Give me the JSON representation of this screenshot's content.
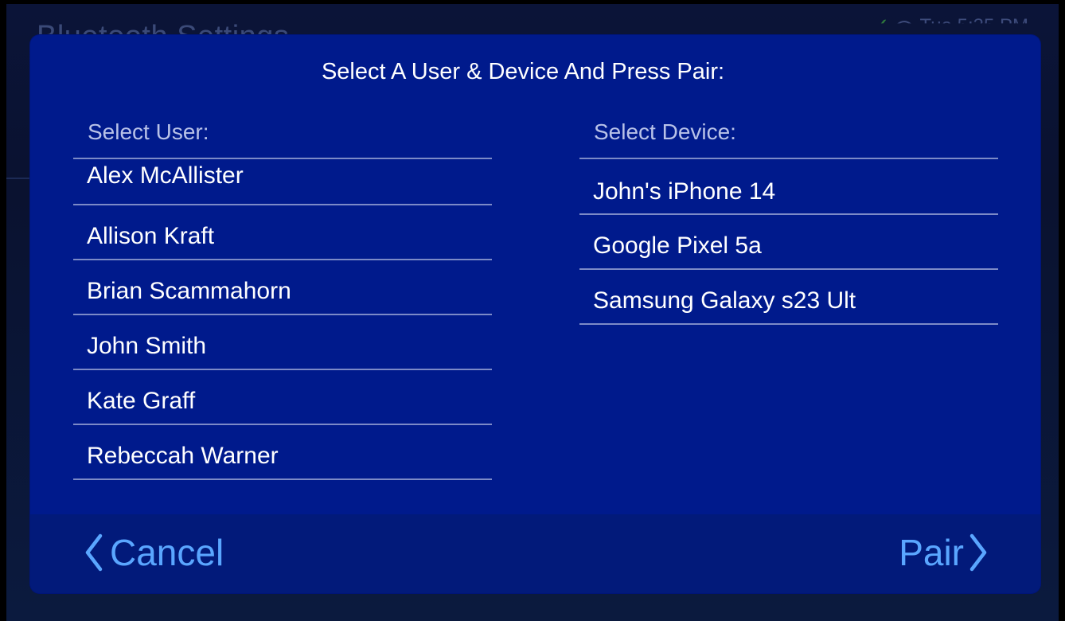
{
  "background": {
    "title": "Bluetooth Settings",
    "status": {
      "check_icon": "check-icon",
      "wifi_icon": "wifi-icon",
      "datetime": "Tue 5:35 PM"
    }
  },
  "dialog": {
    "title": "Select A User & Device And Press Pair:",
    "users": {
      "header": "Select User:",
      "items": [
        "Alex McAllister",
        "Allison Kraft",
        "Brian Scammahorn",
        "John Smith",
        "Kate Graff",
        "Rebeccah Warner"
      ]
    },
    "devices": {
      "header": "Select Device:",
      "items": [
        "John's iPhone 14",
        "Google Pixel 5a",
        "Samsung Galaxy s23 Ult"
      ]
    },
    "footer": {
      "cancel_label": "Cancel",
      "cancel_icon": "chevron-left-icon",
      "pair_label": "Pair",
      "pair_icon": "chevron-right-icon"
    }
  },
  "colors": {
    "dialog_bg": "#001a8c",
    "accent": "#5aa6ff",
    "divider": "#7c8ac7",
    "header_text": "#b8c2e8",
    "text": "#ffffff"
  }
}
